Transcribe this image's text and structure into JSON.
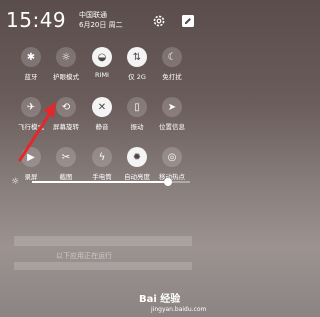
{
  "status_bar": {
    "time": "15:49",
    "carrier": "中国联通",
    "date": "6月20日 周二"
  },
  "quick_settings": {
    "row1": [
      {
        "label": "蓝牙",
        "icon": "bluetooth-icon",
        "glyph": "✱",
        "on": false
      },
      {
        "label": "护眼模式",
        "icon": "eye-comfort-icon",
        "glyph": "☼",
        "on": false
      },
      {
        "label": "RIMI",
        "icon": "wifi-icon",
        "glyph": "◒",
        "on": true
      },
      {
        "label": "仅 2G",
        "icon": "mobile-data-icon",
        "glyph": "⇅",
        "on": true
      },
      {
        "label": "免打扰",
        "icon": "moon-icon",
        "glyph": "☾",
        "on": false
      }
    ],
    "row2": [
      {
        "label": "飞行模式",
        "icon": "airplane-icon",
        "glyph": "✈",
        "on": false
      },
      {
        "label": "屏幕旋转",
        "icon": "rotate-icon",
        "glyph": "⟲",
        "on": false
      },
      {
        "label": "静音",
        "icon": "mute-icon",
        "glyph": "✕",
        "on": true
      },
      {
        "label": "振动",
        "icon": "vibrate-icon",
        "glyph": "▯",
        "on": false
      },
      {
        "label": "位置信息",
        "icon": "location-icon",
        "glyph": "➤",
        "on": false
      }
    ],
    "row3": [
      {
        "label": "录屏",
        "icon": "screen-record-icon",
        "glyph": "▶",
        "on": false
      },
      {
        "label": "截图",
        "icon": "scissors-icon",
        "glyph": "✂",
        "on": false
      },
      {
        "label": "手电筒",
        "icon": "flashlight-icon",
        "glyph": "ϟ",
        "on": false
      },
      {
        "label": "自动亮度",
        "icon": "auto-brightness-icon",
        "glyph": "✹",
        "on": true
      },
      {
        "label": "移动热点",
        "icon": "hotspot-icon",
        "glyph": "◎",
        "on": false
      }
    ]
  },
  "brightness": {
    "level": 0.86
  },
  "notification": {
    "text": "以下应用正在运行"
  },
  "watermark": {
    "brand": "Bai 经验",
    "url": "jingyan.baidu.com"
  },
  "colors": {
    "annotation_arrow": "#e5262b",
    "active_tile": "#f4f4f4"
  }
}
